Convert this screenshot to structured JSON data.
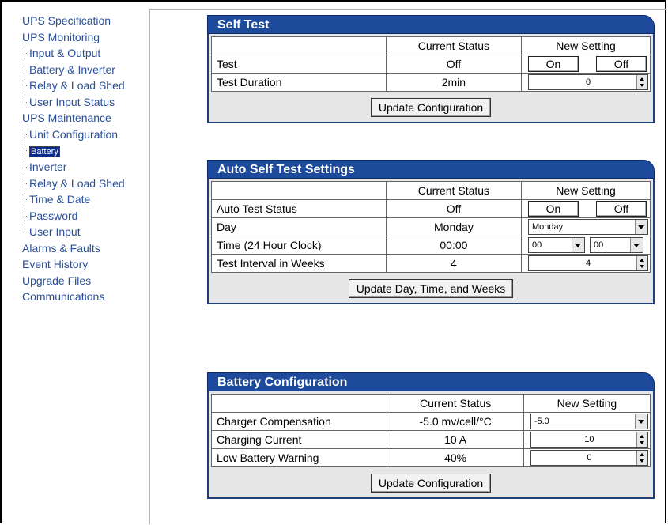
{
  "nav": {
    "ups_specification": "UPS Specification",
    "ups_monitoring": "UPS Monitoring",
    "input_output": "Input & Output",
    "battery_inverter": "Battery & Inverter",
    "relay_load_shed_mon": "Relay & Load Shed",
    "user_input_status": "User Input Status",
    "ups_maintenance": "UPS Maintenance",
    "unit_configuration": "Unit Configuration",
    "battery": "Battery",
    "inverter": "Inverter",
    "relay_load_shed": "Relay & Load Shed",
    "time_date": "Time & Date",
    "password": "Password",
    "user_input": "User Input",
    "alarms_faults": "Alarms & Faults",
    "event_history": "Event History",
    "upgrade_files": "Upgrade Files",
    "communications": "Communications"
  },
  "headers": {
    "current": "Current Status",
    "new": "New Setting"
  },
  "self_test": {
    "title": "Self Test",
    "test_label": "Test",
    "test_status": "Off",
    "on": "On",
    "off": "Off",
    "duration_label": "Test Duration",
    "duration_status": "2min",
    "duration_value": "0",
    "button": "Update Configuration"
  },
  "auto_test": {
    "title": "Auto Self Test Settings",
    "status_label": "Auto Test Status",
    "status_value": "Off",
    "on": "On",
    "off": "Off",
    "day_label": "Day",
    "day_status": "Monday",
    "day_select": "Monday",
    "time_label": "Time (24 Hour Clock)",
    "time_status": "00:00",
    "hour_select": "00",
    "minute_select": "00",
    "interval_label": "Test Interval in Weeks",
    "interval_status": "4",
    "interval_value": "4",
    "button": "Update Day, Time, and Weeks"
  },
  "battery_config": {
    "title": "Battery Configuration",
    "comp_label": "Charger Compensation",
    "comp_status": "-5.0 mv/cell/°C",
    "comp_select": "-5.0",
    "current_label": "Charging Current",
    "current_status": "10 A",
    "current_value": "10",
    "low_label": "Low Battery Warning",
    "low_status": "40%",
    "low_value": "0",
    "button": "Update Configuration"
  }
}
